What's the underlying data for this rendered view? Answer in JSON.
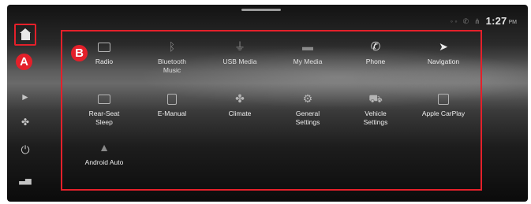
{
  "markers": {
    "a": "A",
    "b": "B"
  },
  "status": {
    "time": "1:27",
    "ampm": "PM",
    "icons": [
      "signal-icon",
      "phone-signal-icon",
      "wifi-icon"
    ]
  },
  "sidebar": {
    "items": [
      {
        "icon": "home-icon"
      },
      {
        "icon": "play-icon"
      },
      {
        "icon": "fan-icon"
      },
      {
        "icon": "power-icon"
      },
      {
        "icon": "vehicle-icon"
      }
    ]
  },
  "apps": [
    {
      "label": "Radio",
      "icon": "radio-icon"
    },
    {
      "label": "Bluetooth\nMusic",
      "icon": "bluetooth-icon"
    },
    {
      "label": "USB Media",
      "icon": "usb-icon"
    },
    {
      "label": "My Media",
      "icon": "folder-icon"
    },
    {
      "label": "Phone",
      "icon": "phone-icon"
    },
    {
      "label": "Navigation",
      "icon": "navigation-arrow-icon"
    },
    {
      "label": "Rear-Seat\nSleep",
      "icon": "rear-seat-sleep-icon"
    },
    {
      "label": "E-Manual",
      "icon": "book-icon"
    },
    {
      "label": "Climate",
      "icon": "fan-icon"
    },
    {
      "label": "General\nSettings",
      "icon": "gear-icon"
    },
    {
      "label": "Vehicle\nSettings",
      "icon": "car-gear-icon"
    },
    {
      "label": "Apple CarPlay",
      "icon": "carplay-icon"
    },
    {
      "label": "Android Auto",
      "icon": "android-auto-icon"
    }
  ]
}
